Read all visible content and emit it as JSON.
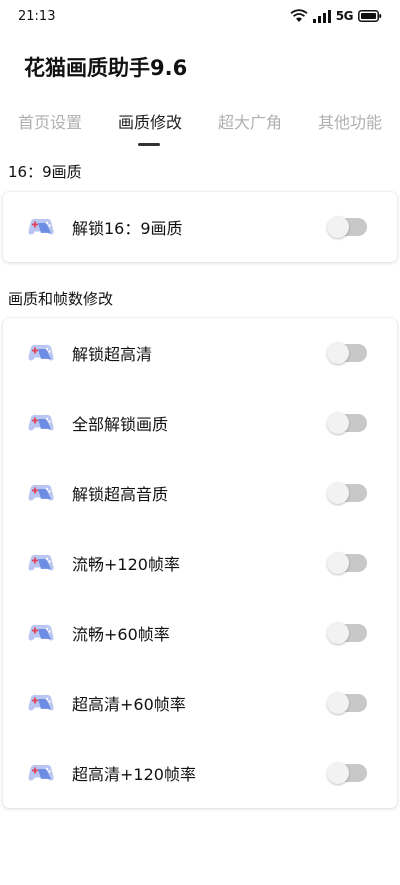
{
  "status_bar": {
    "time": "21:13",
    "network": "5G"
  },
  "app": {
    "title": "花猫画质助手9.6"
  },
  "tabs": [
    {
      "label": "首页设置",
      "active": false
    },
    {
      "label": "画质修改",
      "active": true
    },
    {
      "label": "超大广角",
      "active": false
    },
    {
      "label": "其他功能",
      "active": false
    }
  ],
  "sections": [
    {
      "title": "16：9画质",
      "items": [
        {
          "label": "解锁16：9画质",
          "enabled": false
        }
      ]
    },
    {
      "title": "画质和帧数修改",
      "items": [
        {
          "label": "解锁超高清",
          "enabled": false
        },
        {
          "label": "全部解锁画质",
          "enabled": false
        },
        {
          "label": "解锁超高音质",
          "enabled": false
        },
        {
          "label": "流畅+120帧率",
          "enabled": false
        },
        {
          "label": "流畅+60帧率",
          "enabled": false
        },
        {
          "label": "超高清+60帧率",
          "enabled": false
        },
        {
          "label": "超高清+120帧率",
          "enabled": false
        }
      ]
    }
  ],
  "icons": {
    "item_icon": "gamepad-icon",
    "toggle_off_color": "#c8c8c8"
  }
}
